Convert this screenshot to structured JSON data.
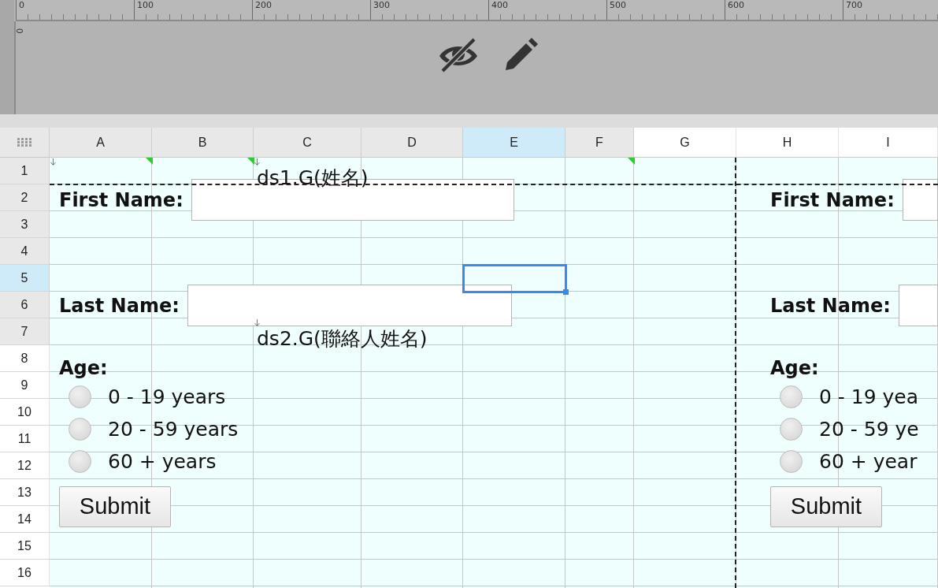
{
  "ruler": {
    "x_labels": [
      "0",
      "100",
      "200",
      "300",
      "400",
      "500",
      "600",
      "700"
    ],
    "y_labels": [
      "0"
    ]
  },
  "columns": [
    {
      "label": "A",
      "selected": false,
      "in_report": true
    },
    {
      "label": "B",
      "selected": false,
      "in_report": true
    },
    {
      "label": "C",
      "selected": false,
      "in_report": true
    },
    {
      "label": "D",
      "selected": false,
      "in_report": true
    },
    {
      "label": "E",
      "selected": true,
      "in_report": true
    },
    {
      "label": "F",
      "selected": false,
      "in_report": true
    },
    {
      "label": "G",
      "selected": false,
      "in_report": false
    },
    {
      "label": "H",
      "selected": false,
      "in_report": false
    },
    {
      "label": "I",
      "selected": false,
      "in_report": false
    }
  ],
  "rows": [
    {
      "label": "1",
      "selected": false,
      "in_report": true,
      "cells": {
        "A": {
          "marker": true,
          "arrow": true
        },
        "B": {
          "marker": true
        },
        "C": {
          "arrow": true,
          "text": "ds1.G(姓名)"
        },
        "F": {
          "marker": true
        }
      }
    },
    {
      "label": "2",
      "selected": false,
      "in_report": true
    },
    {
      "label": "3",
      "selected": false,
      "in_report": true
    },
    {
      "label": "4",
      "selected": false,
      "in_report": true
    },
    {
      "label": "5",
      "selected": true,
      "in_report": true
    },
    {
      "label": "6",
      "selected": false,
      "in_report": true
    },
    {
      "label": "7",
      "selected": false,
      "in_report": true,
      "cells": {
        "C": {
          "arrow": true,
          "text": "ds2.G(聯絡人姓名)"
        }
      }
    },
    {
      "label": "8",
      "selected": false,
      "in_report": false
    },
    {
      "label": "9",
      "selected": false,
      "in_report": false
    },
    {
      "label": "10",
      "selected": false,
      "in_report": false
    },
    {
      "label": "11",
      "selected": false,
      "in_report": false
    },
    {
      "label": "12",
      "selected": false,
      "in_report": false
    },
    {
      "label": "13",
      "selected": false,
      "in_report": false
    },
    {
      "label": "14",
      "selected": false,
      "in_report": false
    },
    {
      "label": "15",
      "selected": false,
      "in_report": false
    },
    {
      "label": "16",
      "selected": false,
      "in_report": false
    }
  ],
  "forms": [
    {
      "first_name_label": "First Name:",
      "last_name_label": "Last Name:",
      "age_label": "Age:",
      "options": [
        {
          "label": "0 - 19 years",
          "selected": false
        },
        {
          "label": "20 - 59 years",
          "selected": false
        },
        {
          "label": "60 + years",
          "selected": false
        }
      ],
      "submit": "Submit"
    },
    {
      "first_name_label": "First Name:",
      "last_name_label": "Last Name:",
      "age_label": "Age:",
      "options": [
        {
          "label": "0 - 19 yea",
          "selected": false
        },
        {
          "label": "20 - 59 ye",
          "selected": false
        },
        {
          "label": "60 + year",
          "selected": false
        }
      ],
      "submit": "Submit"
    }
  ]
}
